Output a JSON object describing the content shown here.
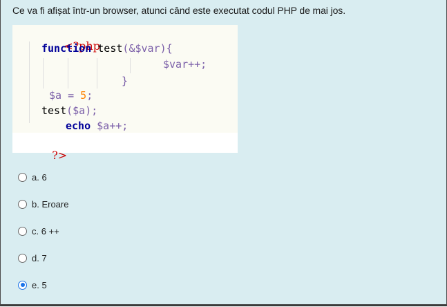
{
  "question": {
    "text": "Ce va fi afișat într-un browser, atunci când este executat codul PHP de mai jos."
  },
  "code": {
    "open_tag": "<?php",
    "kw_function": "function",
    "fn_test": "test",
    "paren_open": "(",
    "ref_var": "&$var",
    "paren_close_brace": "){",
    "var_incr": "$var++;",
    "brace_close": "}",
    "var_a": "$a",
    "eq": "=",
    "five": "5",
    "semicolon": ";",
    "call_test": "test",
    "call_args_open": "(",
    "call_arg": "$a",
    "call_args_close": ");",
    "kw_echo": "echo",
    "echo_expr": "$a++;",
    "close_tag": "?>"
  },
  "options": [
    {
      "label": "a. 6",
      "selected": false
    },
    {
      "label": "b. Eroare",
      "selected": false
    },
    {
      "label": "c. 6 ++",
      "selected": false
    },
    {
      "label": "d. 7",
      "selected": false
    },
    {
      "label": "e. 5",
      "selected": true
    }
  ],
  "colors": {
    "background": "#d9edf1",
    "accent": "#1a73e8",
    "php_tag": "#cc0000",
    "keyword": "#000099",
    "variable": "#7a5ea8",
    "number": "#ff8000"
  }
}
